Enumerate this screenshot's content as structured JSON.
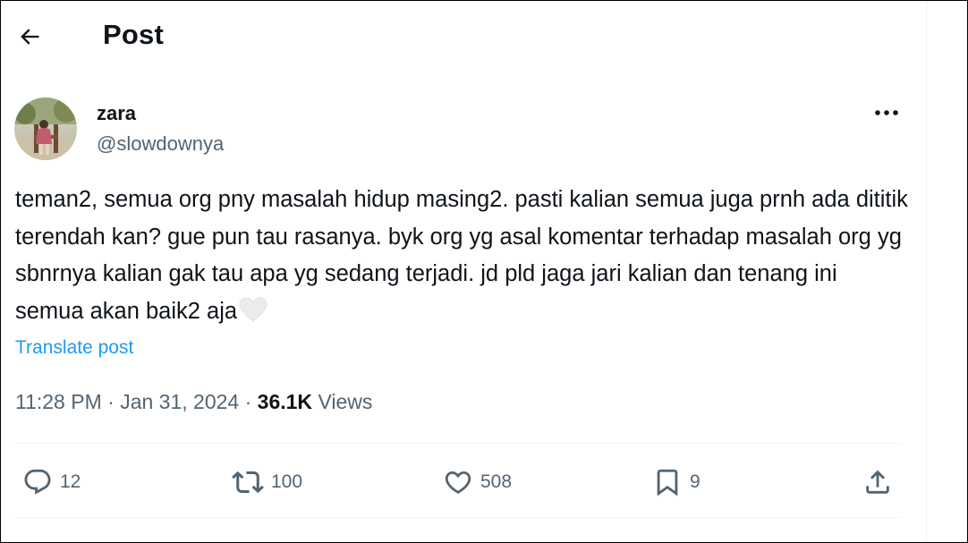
{
  "header": {
    "back_icon": "arrow-left-icon",
    "title": "Post"
  },
  "author": {
    "display_name": "zara",
    "handle": "@slowdownya",
    "more_icon": "more-horizontal-icon"
  },
  "tweet": {
    "text": "teman2, semua org pny masalah hidup masing2. pasti kalian semua juga prnh ada dititik terendah kan? gue pun tau rasanya. byk org yg asal komentar terhadap masalah org yg sbnrnya kalian gak tau apa yg sedang terjadi. jd pld jaga jari kalian dan tenang ini semua akan baik2 aja",
    "emoji": "white-heart-emoji",
    "translate_label": "Translate post"
  },
  "meta": {
    "time": "11:28 PM",
    "separator": "·",
    "date": "Jan 31, 2024",
    "views_count": "36.1K",
    "views_label": "Views"
  },
  "actions": {
    "reply": {
      "icon": "reply-icon",
      "count": "12"
    },
    "repost": {
      "icon": "repost-icon",
      "count": "100"
    },
    "like": {
      "icon": "heart-icon",
      "count": "508"
    },
    "bookmark": {
      "icon": "bookmark-icon",
      "count": "9"
    },
    "share": {
      "icon": "share-icon"
    }
  },
  "colors": {
    "text_primary": "#0f1419",
    "text_secondary": "#536471",
    "link": "#1d9bf0",
    "divider": "#eff3f4"
  }
}
